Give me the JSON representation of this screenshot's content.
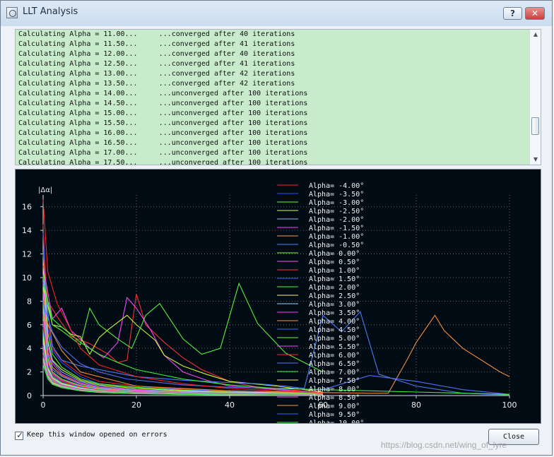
{
  "window": {
    "title": "LLT Analysis",
    "help_label": "?",
    "close_label": "✕"
  },
  "log": {
    "lines": [
      "Calculating Alpha = 11.00...     ...converged after 40 iterations",
      "Calculating Alpha = 11.50...     ...converged after 41 iterations",
      "Calculating Alpha = 12.00...     ...converged after 40 iterations",
      "Calculating Alpha = 12.50...     ...converged after 41 iterations",
      "Calculating Alpha = 13.00...     ...converged after 42 iterations",
      "Calculating Alpha = 13.50...     ...converged after 42 iterations",
      "Calculating Alpha = 14.00...     ...unconverged after 100 iterations",
      "Calculating Alpha = 14.50...     ...unconverged after 100 iterations",
      "Calculating Alpha = 15.00...     ...unconverged after 100 iterations",
      "Calculating Alpha = 15.50...     ...unconverged after 100 iterations",
      "Calculating Alpha = 16.00...     ...unconverged after 100 iterations",
      "Calculating Alpha = 16.50...     ...unconverged after 100 iterations",
      "Calculating Alpha = 17.00...     ...unconverged after 100 iterations",
      "Calculating Alpha = 17.50...     ...unconverged after 100 iterations"
    ]
  },
  "chart_data": {
    "type": "line",
    "ylabel": "|Δα|",
    "xlim": [
      0,
      100
    ],
    "ylim": [
      0,
      17
    ],
    "xticks": [
      0,
      20,
      40,
      60,
      80,
      100
    ],
    "yticks": [
      0,
      2,
      4,
      6,
      8,
      10,
      12,
      14,
      16
    ],
    "legend_position": "right",
    "series": [
      {
        "name": "Alpha=  -4.00°",
        "color": "#ff2626",
        "x": [
          0,
          1,
          2,
          4,
          8,
          12,
          20,
          30,
          40,
          60
        ],
        "y": [
          14.5,
          6.2,
          4.0,
          3.0,
          1.8,
          1.2,
          0.8,
          0.55,
          0.4,
          0.2
        ]
      },
      {
        "name": "Alpha=  -3.50°",
        "color": "#2b4dff",
        "x": [
          0,
          1,
          2,
          4,
          8,
          12,
          20,
          30,
          40,
          60
        ],
        "y": [
          13.8,
          5.7,
          3.8,
          2.8,
          1.6,
          1.0,
          0.7,
          0.5,
          0.35,
          0.2
        ]
      },
      {
        "name": "Alpha=  -3.00°",
        "color": "#5dff3f",
        "x": [
          0,
          1,
          2,
          4,
          8,
          12,
          20,
          30,
          40,
          60
        ],
        "y": [
          12.2,
          5.3,
          3.5,
          2.4,
          1.4,
          1.0,
          0.7,
          0.45,
          0.3,
          0.18
        ]
      },
      {
        "name": "Alpha=  -2.50°",
        "color": "#d7ff3a",
        "x": [
          0,
          1,
          2,
          4,
          8,
          12,
          20,
          30,
          40,
          60
        ],
        "y": [
          11.0,
          4.7,
          3.0,
          2.2,
          1.3,
          0.9,
          0.6,
          0.4,
          0.3,
          0.15
        ]
      },
      {
        "name": "Alpha=  -2.00°",
        "color": "#8dbbff",
        "x": [
          0,
          1,
          2,
          4,
          8,
          12,
          20,
          30,
          40,
          60
        ],
        "y": [
          10.3,
          4.5,
          2.9,
          2.0,
          1.2,
          0.8,
          0.5,
          0.35,
          0.25,
          0.12
        ]
      },
      {
        "name": "Alpha=  -1.50°",
        "color": "#ff40ff",
        "x": [
          0,
          1,
          2,
          4,
          8,
          12,
          20,
          30,
          40,
          60
        ],
        "y": [
          9.6,
          4.1,
          2.7,
          1.8,
          1.1,
          0.7,
          0.45,
          0.3,
          0.2,
          0.1
        ]
      },
      {
        "name": "Alpha=  -1.00°",
        "color": "#ff9d41",
        "x": [
          0,
          1,
          2,
          4,
          8,
          12,
          20,
          30,
          40,
          60
        ],
        "y": [
          8.8,
          3.7,
          2.4,
          1.7,
          1.0,
          0.65,
          0.4,
          0.28,
          0.2,
          0.1
        ]
      },
      {
        "name": "Alpha=  -0.50°",
        "color": "#4f84ff",
        "x": [
          0,
          1,
          2,
          4,
          8,
          12,
          20,
          30,
          40,
          60
        ],
        "y": [
          8.1,
          3.5,
          2.2,
          1.6,
          0.95,
          0.6,
          0.38,
          0.25,
          0.18,
          0.1
        ]
      },
      {
        "name": "Alpha=   0.00°",
        "color": "#80ff40",
        "x": [
          0,
          1,
          2,
          4,
          8,
          12,
          20,
          30,
          40,
          60
        ],
        "y": [
          7.5,
          3.2,
          2.0,
          1.4,
          0.85,
          0.55,
          0.35,
          0.24,
          0.16,
          0.08
        ]
      },
      {
        "name": "Alpha=   0.50°",
        "color": "#ff54ff",
        "x": [
          0,
          1,
          2,
          4,
          8,
          12,
          20,
          30,
          40,
          60
        ],
        "y": [
          6.9,
          3.0,
          1.9,
          1.3,
          0.8,
          0.5,
          0.33,
          0.22,
          0.15,
          0.08
        ]
      },
      {
        "name": "Alpha=   1.00°",
        "color": "#ff3434",
        "x": [
          0,
          1,
          2,
          4,
          8,
          12,
          20,
          30,
          40,
          60
        ],
        "y": [
          6.3,
          2.8,
          1.8,
          1.2,
          0.75,
          0.48,
          0.3,
          0.2,
          0.14,
          0.08
        ]
      },
      {
        "name": "Alpha=   1.50°",
        "color": "#3b5bff",
        "x": [
          0,
          1,
          2,
          4,
          8,
          12,
          20,
          30,
          40,
          60
        ],
        "y": [
          5.8,
          2.6,
          1.7,
          1.1,
          0.7,
          0.44,
          0.28,
          0.2,
          0.13,
          0.07
        ]
      },
      {
        "name": "Alpha=   2.00°",
        "color": "#3dff3d",
        "x": [
          0,
          1,
          2,
          4,
          8,
          12,
          20,
          30,
          40,
          60
        ],
        "y": [
          5.4,
          2.4,
          1.6,
          1.05,
          0.65,
          0.42,
          0.27,
          0.18,
          0.12,
          0.07
        ]
      },
      {
        "name": "Alpha=   2.50°",
        "color": "#fff06a",
        "x": [
          0,
          1,
          2,
          4,
          8,
          12,
          20,
          30,
          40,
          60
        ],
        "y": [
          5.0,
          2.3,
          1.5,
          1.0,
          0.62,
          0.4,
          0.26,
          0.17,
          0.11,
          0.06
        ]
      },
      {
        "name": "Alpha=   3.00°",
        "color": "#9ad8ff",
        "x": [
          0,
          1,
          2,
          4,
          8,
          12,
          20,
          30,
          40,
          60
        ],
        "y": [
          4.6,
          2.2,
          1.45,
          0.95,
          0.58,
          0.38,
          0.25,
          0.16,
          0.1,
          0.06
        ]
      },
      {
        "name": "Alpha=   3.50°",
        "color": "#ff36ff",
        "x": [
          0,
          1,
          2,
          4,
          8,
          12,
          20,
          30,
          40,
          60
        ],
        "y": [
          4.3,
          2.1,
          1.4,
          0.92,
          0.56,
          0.37,
          0.24,
          0.15,
          0.1,
          0.06
        ]
      },
      {
        "name": "Alpha=   4.00°",
        "color": "#ff953f",
        "x": [
          0,
          1,
          2,
          4,
          8,
          12,
          20,
          30,
          40,
          60
        ],
        "y": [
          4.0,
          2.0,
          1.35,
          0.9,
          0.54,
          0.36,
          0.23,
          0.15,
          0.1,
          0.05
        ]
      },
      {
        "name": "Alpha=   4.50°",
        "color": "#356dff",
        "x": [
          0,
          1,
          2,
          4,
          8,
          12,
          20,
          30,
          40,
          60
        ],
        "y": [
          3.8,
          1.95,
          1.3,
          0.88,
          0.52,
          0.35,
          0.22,
          0.14,
          0.09,
          0.05
        ]
      },
      {
        "name": "Alpha=   5.00°",
        "color": "#5dff3f",
        "x": [
          0,
          1,
          2,
          4,
          8,
          12,
          20,
          30,
          40,
          60
        ],
        "y": [
          3.6,
          1.9,
          1.25,
          0.85,
          0.5,
          0.34,
          0.21,
          0.14,
          0.09,
          0.05
        ]
      },
      {
        "name": "Alpha=   5.50°",
        "color": "#ff43ff",
        "x": [
          0,
          1,
          2,
          4,
          8,
          12,
          20,
          30,
          40,
          60
        ],
        "y": [
          3.5,
          1.85,
          1.2,
          0.84,
          0.49,
          0.33,
          0.2,
          0.13,
          0.08,
          0.05
        ]
      },
      {
        "name": "Alpha=   6.00°",
        "color": "#ff2a2a",
        "x": [
          0,
          1,
          2,
          4,
          8,
          12,
          20,
          30,
          40,
          60
        ],
        "y": [
          3.4,
          1.8,
          1.2,
          0.82,
          0.48,
          0.32,
          0.2,
          0.13,
          0.08,
          0.05
        ]
      },
      {
        "name": "Alpha=   6.50°",
        "color": "#5775ff",
        "x": [
          0,
          1,
          2,
          4,
          8,
          12,
          20,
          30,
          40,
          60
        ],
        "y": [
          3.3,
          1.75,
          1.15,
          0.8,
          0.47,
          0.31,
          0.19,
          0.12,
          0.08,
          0.04
        ]
      },
      {
        "name": "Alpha=   7.00°",
        "color": "#40ff40",
        "x": [
          0,
          1,
          2,
          4,
          8,
          12,
          20,
          30,
          40,
          60
        ],
        "y": [
          3.2,
          1.7,
          1.1,
          0.78,
          0.46,
          0.3,
          0.19,
          0.12,
          0.08,
          0.04
        ]
      },
      {
        "name": "Alpha=   7.50°",
        "color": "#ffee51",
        "x": [
          0,
          1,
          2,
          4,
          8,
          12,
          20,
          30,
          40,
          60
        ],
        "y": [
          3.1,
          1.65,
          1.1,
          0.76,
          0.45,
          0.3,
          0.18,
          0.11,
          0.07,
          0.04
        ]
      },
      {
        "name": "Alpha=   8.00°",
        "color": "#7ad0ff",
        "x": [
          0,
          1,
          2,
          4,
          8,
          12,
          20,
          30,
          40,
          60
        ],
        "y": [
          3.0,
          1.6,
          1.05,
          0.74,
          0.44,
          0.29,
          0.18,
          0.11,
          0.07,
          0.04
        ]
      },
      {
        "name": "Alpha=   8.50°",
        "color": "#ff59ff",
        "x": [
          0,
          1,
          2,
          4,
          8,
          12,
          20,
          30,
          40,
          60
        ],
        "y": [
          2.9,
          1.55,
          1.0,
          0.72,
          0.43,
          0.28,
          0.18,
          0.11,
          0.07,
          0.04
        ]
      },
      {
        "name": "Alpha=   9.00°",
        "color": "#ff923c",
        "x": [
          0,
          1,
          2,
          4,
          8,
          12,
          20,
          30,
          40,
          60
        ],
        "y": [
          2.8,
          1.5,
          1.0,
          0.7,
          0.42,
          0.28,
          0.17,
          0.1,
          0.07,
          0.04
        ]
      },
      {
        "name": "Alpha=   9.50°",
        "color": "#3d63ff",
        "x": [
          0,
          1,
          2,
          4,
          8,
          12,
          20,
          30,
          40,
          60
        ],
        "y": [
          2.7,
          1.45,
          0.95,
          0.68,
          0.41,
          0.27,
          0.17,
          0.1,
          0.06,
          0.03
        ]
      },
      {
        "name": "Alpha=  10.00°",
        "color": "#39ff39",
        "x": [
          0,
          1,
          2,
          4,
          8,
          12,
          20,
          30,
          40,
          60
        ],
        "y": [
          2.6,
          1.4,
          0.95,
          0.66,
          0.4,
          0.26,
          0.16,
          0.1,
          0.06,
          0.03
        ]
      }
    ],
    "unlabeled_series": [
      {
        "color": "#ff3434",
        "x": [
          0,
          1,
          3,
          6,
          10,
          14,
          16,
          18,
          20,
          22,
          26,
          30,
          34,
          40,
          46,
          52,
          60
        ],
        "y": [
          12.0,
          8.0,
          6.7,
          5.0,
          4.4,
          3.5,
          2.8,
          3.0,
          8.6,
          6.0,
          4.5,
          3.2,
          2.2,
          1.2,
          0.7,
          0.5,
          0.3
        ]
      },
      {
        "color": "#ff4dff",
        "x": [
          0,
          2,
          4,
          6,
          8,
          10,
          13,
          16,
          18,
          20,
          23,
          26,
          30,
          35,
          40,
          50,
          60
        ],
        "y": [
          11.0,
          6.5,
          7.4,
          5.5,
          4.8,
          4.0,
          3.2,
          4.5,
          8.3,
          7.4,
          5.6,
          3.4,
          2.0,
          1.3,
          0.8,
          0.5,
          0.2
        ]
      },
      {
        "color": "#d7ff3a",
        "x": [
          0,
          2,
          4,
          6,
          8,
          10,
          12,
          14,
          18,
          20,
          24,
          26,
          30,
          35,
          40,
          50,
          60
        ],
        "y": [
          9.2,
          6.0,
          5.8,
          5.2,
          5.0,
          3.5,
          4.9,
          5.6,
          6.8,
          6.0,
          4.7,
          3.4,
          2.5,
          1.8,
          1.2,
          0.8,
          0.3
        ]
      },
      {
        "color": "#5dff3f",
        "x": [
          0,
          2,
          4,
          8,
          10,
          12,
          16,
          19,
          22,
          25,
          30,
          34,
          38,
          42,
          46,
          52,
          60
        ],
        "y": [
          10.0,
          6.0,
          5.5,
          4.3,
          7.4,
          6.0,
          4.8,
          4.0,
          6.8,
          7.8,
          4.8,
          3.5,
          4.0,
          9.5,
          6.1,
          3.6,
          2.0
        ]
      },
      {
        "color": "#4f84ff",
        "x": [
          0,
          2,
          4,
          8,
          12,
          20,
          30,
          40,
          46,
          52,
          56,
          60,
          64,
          68,
          72,
          76,
          80,
          90,
          100
        ],
        "y": [
          10.2,
          4.2,
          3.0,
          2.5,
          2.2,
          1.6,
          1.3,
          1.1,
          1.0,
          0.8,
          0.6,
          6.8,
          5.4,
          7.1,
          1.8,
          1.3,
          0.8,
          0.2,
          0.05
        ]
      },
      {
        "color": "#ff953f",
        "x": [
          0,
          4,
          8,
          20,
          40,
          60,
          70,
          74,
          78,
          80,
          84,
          86,
          90,
          94,
          98,
          100
        ],
        "y": [
          6.8,
          3.8,
          2.0,
          0.8,
          0.4,
          0.25,
          0.2,
          0.2,
          3.0,
          4.5,
          6.8,
          5.5,
          4.0,
          3.0,
          2.0,
          1.6
        ]
      },
      {
        "color": "#5775ff",
        "x": [
          0,
          2,
          4,
          8,
          12,
          18,
          30,
          40,
          60,
          70,
          80,
          90,
          100
        ],
        "y": [
          7.8,
          5.4,
          4.1,
          2.7,
          2.0,
          1.4,
          0.9,
          0.7,
          0.5,
          1.7,
          1.2,
          0.5,
          0.1
        ]
      },
      {
        "color": "#40ff40",
        "x": [
          0,
          2,
          4,
          8,
          12,
          16,
          20,
          30,
          40,
          50,
          60,
          70,
          80,
          90,
          100
        ],
        "y": [
          9.5,
          6.5,
          5.8,
          4.5,
          3.5,
          2.8,
          2.2,
          1.4,
          0.9,
          0.6,
          0.5,
          0.4,
          0.3,
          0.2,
          0.1
        ]
      },
      {
        "color": "#ff2626",
        "x": [
          0,
          1,
          3,
          8,
          12,
          20,
          30,
          40,
          50,
          60
        ],
        "y": [
          16.6,
          10.5,
          7.8,
          4.0,
          2.6,
          1.6,
          1.0,
          0.6,
          0.4,
          0.2
        ]
      }
    ]
  },
  "footer": {
    "checkbox_label": "Keep this window opened on errors",
    "checkbox_checked": "✓",
    "close_label": "Close",
    "watermark": "https://blog.csdn.net/wing_of_lyre"
  }
}
